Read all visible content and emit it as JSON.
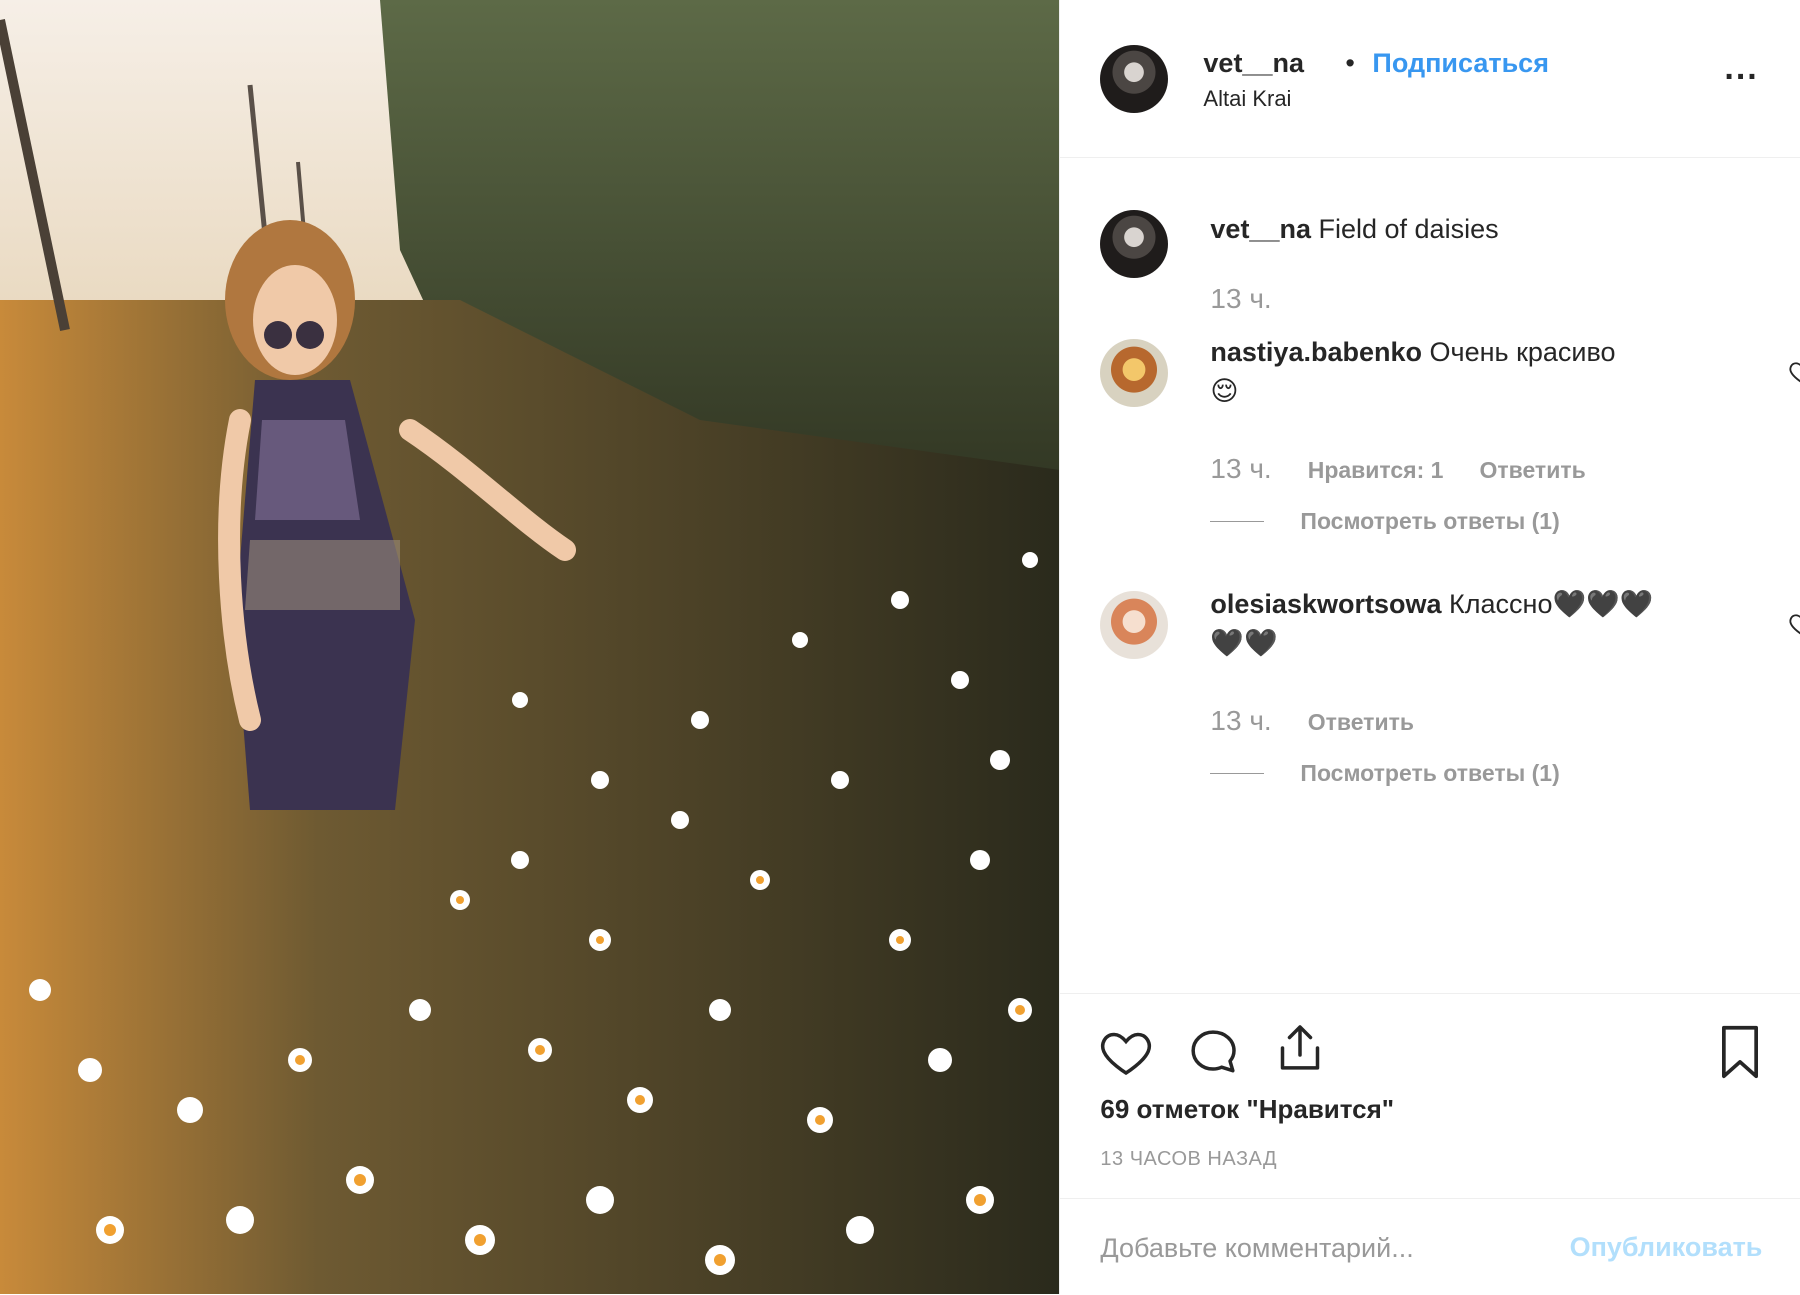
{
  "post": {
    "username": "vet__na",
    "dot": "•",
    "follow_label": "Подписаться",
    "location": "Altai Krai",
    "more_label": "..."
  },
  "caption": {
    "username": "vet__na",
    "text": "Field of daisies",
    "time": "13 ч."
  },
  "comments": [
    {
      "username": "nastiya.babenko",
      "text": "Очень красиво",
      "emoji": "😌",
      "time": "13 ч.",
      "likes_label": "Нравится: 1",
      "reply_label": "Ответить",
      "view_replies": "Посмотреть ответы (1)"
    },
    {
      "username": "olesiaskwortsowa",
      "text": "Классно🖤🖤🖤",
      "text2": "🖤🖤",
      "time": "13 ч.",
      "reply_label": "Ответить",
      "view_replies": "Посмотреть ответы (1)"
    }
  ],
  "stats": {
    "likes": "69 отметок \"Нравится\"",
    "posted_ago": "13 ЧАСОВ НАЗАД"
  },
  "composer": {
    "placeholder": "Добавьте комментарий...",
    "publish_label": "Опубликовать"
  },
  "icons": {
    "like": "heart-icon",
    "comment": "comment-icon",
    "share": "share-icon",
    "save": "bookmark-icon",
    "more": "more-options-icon",
    "comment_like": "heart-outline-icon"
  },
  "colors": {
    "accent": "#3897f0",
    "muted": "#999999",
    "publish_disabled": "#b2dffc",
    "text": "#262626"
  }
}
